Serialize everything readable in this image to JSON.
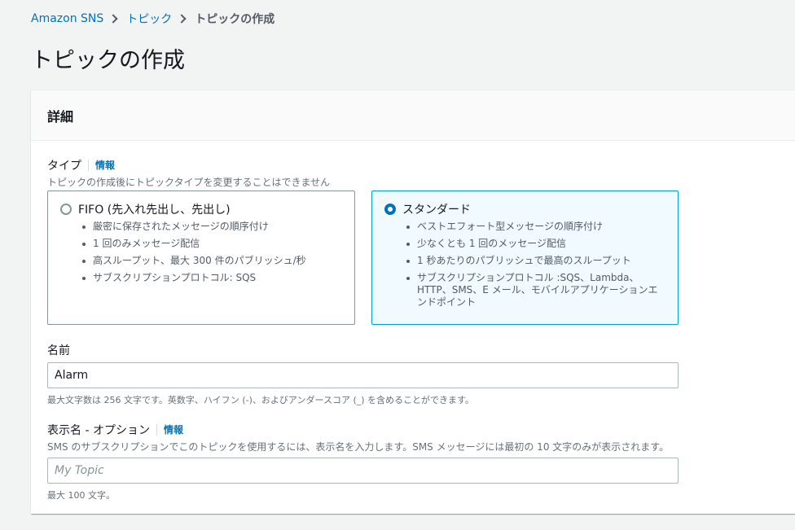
{
  "breadcrumb": {
    "items": [
      "Amazon SNS",
      "トピック"
    ],
    "current": "トピックの作成"
  },
  "page": {
    "title": "トピックの作成"
  },
  "panel": {
    "title": "詳細"
  },
  "type_field": {
    "label": "タイプ",
    "info": "情報",
    "description": "トピックの作成後にトピックタイプを変更することはできません",
    "options": [
      {
        "title": "FIFO (先入れ先出し、先出し)",
        "selected": false,
        "bullets": [
          "厳密に保存されたメッセージの順序付け",
          "1 回のみメッセージ配信",
          "高スループット、最大 300 件のパブリッシュ/秒",
          "サブスクリプションプロトコル: SQS"
        ]
      },
      {
        "title": "スタンダード",
        "selected": true,
        "bullets": [
          "ベストエフォート型メッセージの順序付け",
          "少なくとも 1 回のメッセージ配信",
          "1 秒あたりのパブリッシュで最高のスループット",
          "サブスクリプションプロトコル :SQS、Lambda、HTTP、SMS、E メール、モバイルアプリケーションエンドポイント"
        ]
      }
    ]
  },
  "name_field": {
    "label": "名前",
    "value": "Alarm",
    "hint": "最大文字数は 256 文字です。英数字、ハイフン (-)、およびアンダースコア (_) を含めることができます。"
  },
  "display_name_field": {
    "label": "表示名 - オプション",
    "info": "情報",
    "description": "SMS のサブスクリプションでこのトピックを使用するには、表示名を入力します。SMS メッセージには最初の 10 文字のみが表示されます。",
    "placeholder": "My Topic",
    "hint": "最大 100 文字。"
  },
  "colors": {
    "link": "#0073bb",
    "selected_border": "#00a1c9",
    "selected_bg": "#f1faff"
  }
}
